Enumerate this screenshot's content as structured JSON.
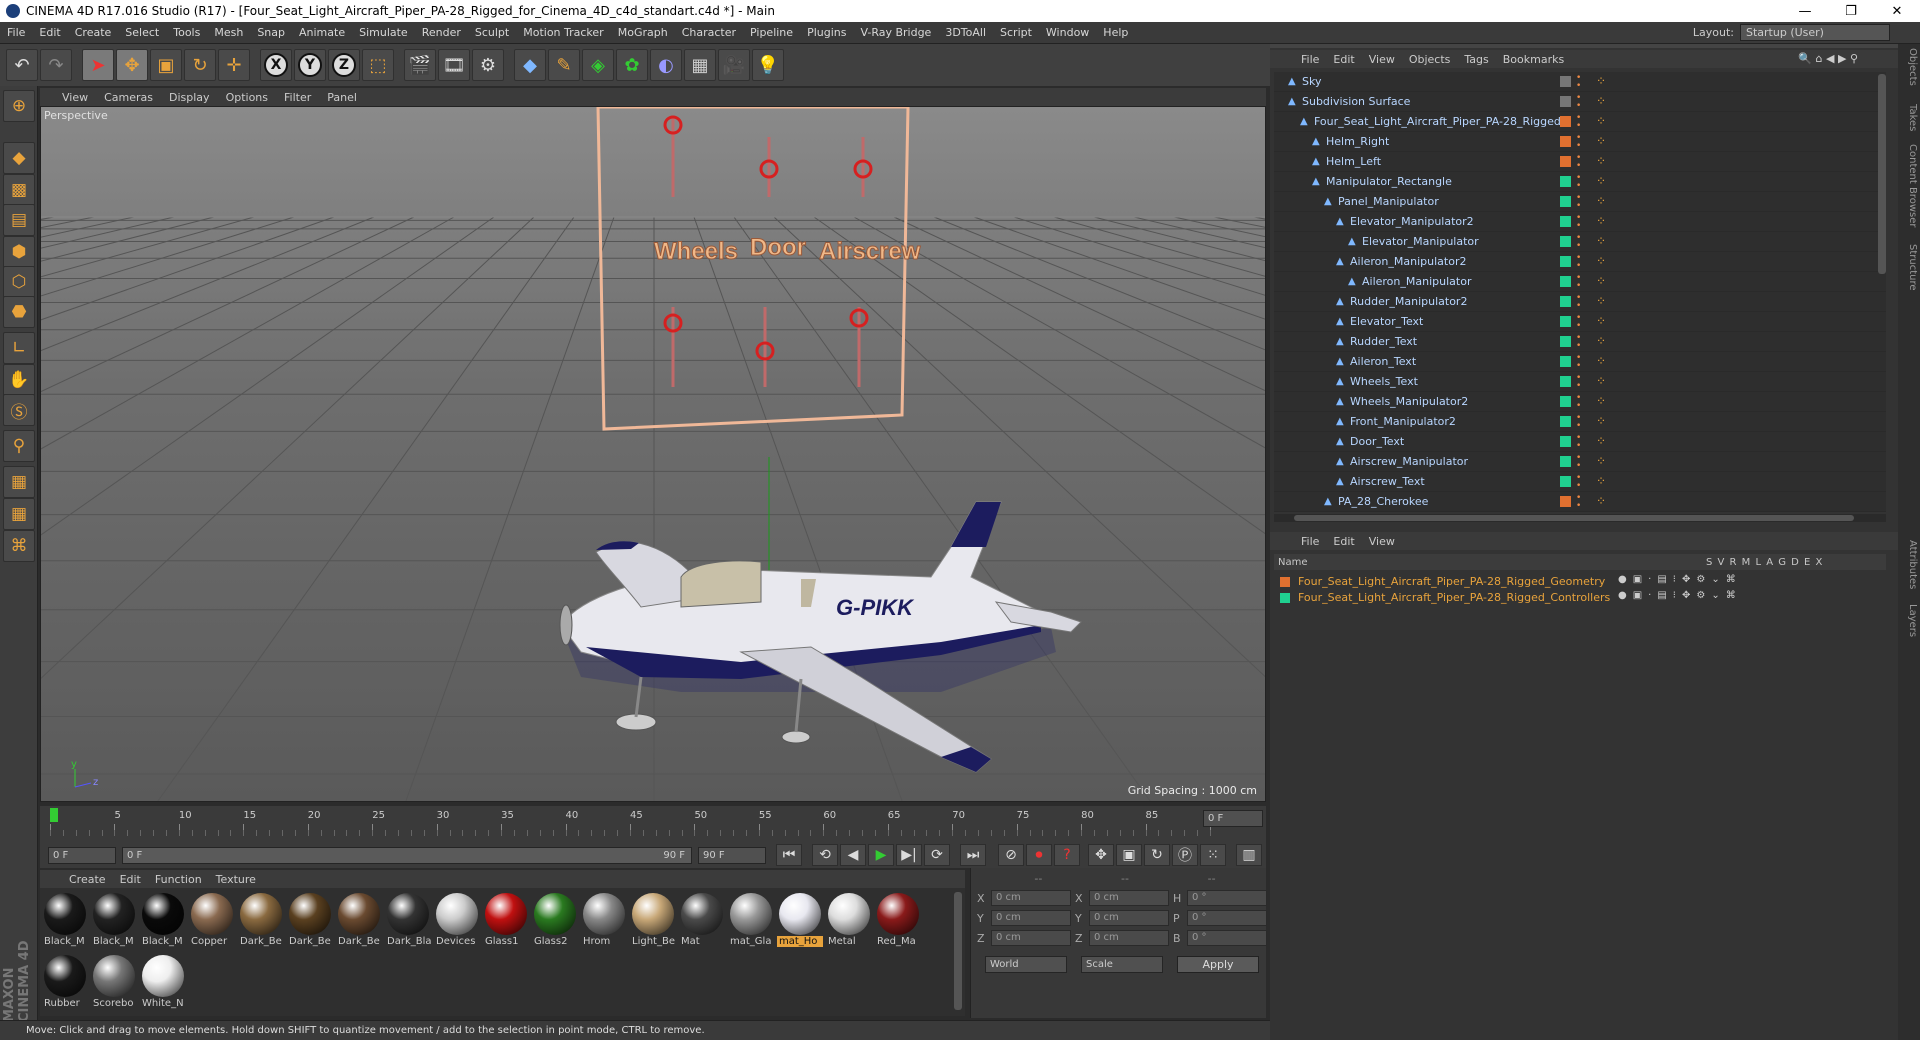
{
  "window": {
    "title": "CINEMA 4D R17.016 Studio (R17) - [Four_Seat_Light_Aircraft_Piper_PA-28_Rigged_for_Cinema_4D_c4d_standart.c4d *] - Main"
  },
  "menu": [
    "File",
    "Edit",
    "Create",
    "Select",
    "Tools",
    "Mesh",
    "Snap",
    "Animate",
    "Simulate",
    "Render",
    "Sculpt",
    "Motion Tracker",
    "MoGraph",
    "Character",
    "Pipeline",
    "Plugins",
    "V-Ray Bridge",
    "3DToAll",
    "Script",
    "Window",
    "Help"
  ],
  "layout": {
    "label": "Layout:",
    "value": "Startup (User)"
  },
  "viewport": {
    "menu": [
      "View",
      "Cameras",
      "Display",
      "Options",
      "Filter",
      "Panel"
    ],
    "label": "Perspective",
    "grid_spacing": "Grid Spacing : 1000 cm",
    "panel_labels": [
      "Wheels",
      "Door",
      "Airscrew"
    ],
    "aircraft_reg": "G-PIKK",
    "axis_y": "y",
    "axis_z": "z"
  },
  "timeline": {
    "ticks": [
      "0",
      "5",
      "10",
      "15",
      "20",
      "25",
      "30",
      "35",
      "40",
      "45",
      "50",
      "55",
      "60",
      "65",
      "70",
      "75",
      "80",
      "85",
      "90"
    ],
    "current": "0 F",
    "start": "0 F",
    "range_start": "0 F",
    "range_end": "90 F",
    "end": "90 F"
  },
  "materials": {
    "menu": [
      "Create",
      "Edit",
      "Function",
      "Texture"
    ],
    "items": [
      {
        "name": "Black_M",
        "color": "#1a1a1a"
      },
      {
        "name": "Black_M",
        "color": "#222222"
      },
      {
        "name": "Black_M",
        "color": "#0a0a0a"
      },
      {
        "name": "Copper",
        "color": "#8a6a50"
      },
      {
        "name": "Dark_Be",
        "color": "#8a6a40"
      },
      {
        "name": "Dark_Be",
        "color": "#5a4020"
      },
      {
        "name": "Dark_Be",
        "color": "#6a4a30"
      },
      {
        "name": "Dark_Bla",
        "color": "#333333"
      },
      {
        "name": "Devices",
        "color": "#cccccc"
      },
      {
        "name": "Glass1",
        "color": "#c01010"
      },
      {
        "name": "Glass2",
        "color": "#2a7a20"
      },
      {
        "name": "Hrom",
        "color": "#888888"
      },
      {
        "name": "Light_Be",
        "color": "#c8a878"
      },
      {
        "name": "Mat",
        "color": "#4a4a4a"
      },
      {
        "name": "mat_Gla",
        "color": "#999999"
      },
      {
        "name": "mat_Ho",
        "color": "#e8e8f0"
      },
      {
        "name": "Metal",
        "color": "#dddddd"
      },
      {
        "name": "Red_Ma",
        "color": "#8a1a1a"
      },
      {
        "name": "Rubber",
        "color": "#1a1a1a"
      },
      {
        "name": "Scorebo",
        "color": "#777777"
      },
      {
        "name": "White_N",
        "color": "#eeeeee"
      }
    ]
  },
  "coords": {
    "headers": [
      "--",
      "--",
      "--"
    ],
    "rows": [
      {
        "a": "X",
        "av": "0 cm",
        "b": "X",
        "bv": "0 cm",
        "c": "H",
        "cv": "0 °"
      },
      {
        "a": "Y",
        "av": "0 cm",
        "b": "Y",
        "bv": "0 cm",
        "c": "P",
        "cv": "0 °"
      },
      {
        "a": "Z",
        "av": "0 cm",
        "b": "Z",
        "bv": "0 cm",
        "c": "B",
        "cv": "0 °"
      }
    ],
    "mode": "World",
    "scale": "Scale",
    "apply": "Apply"
  },
  "status": "Move: Click and drag to move elements. Hold down SHIFT to quantize movement / add to the selection in point mode, CTRL to remove.",
  "objects": {
    "menu": [
      "File",
      "Edit",
      "View",
      "Objects",
      "Tags",
      "Bookmarks"
    ],
    "rows": [
      {
        "name": "Sky",
        "indent": 0,
        "color": "#777777"
      },
      {
        "name": "Subdivision Surface",
        "indent": 0,
        "color": "#777777"
      },
      {
        "name": "Four_Seat_Light_Aircraft_Piper_PA-28_Rigged",
        "indent": 1,
        "color": "#e07030"
      },
      {
        "name": "Helm_Right",
        "indent": 2,
        "color": "#e07030"
      },
      {
        "name": "Helm_Left",
        "indent": 2,
        "color": "#e07030"
      },
      {
        "name": "Manipulator_Rectangle",
        "indent": 2,
        "color": "#20d090"
      },
      {
        "name": "Panel_Manipulator",
        "indent": 3,
        "color": "#20d090"
      },
      {
        "name": "Elevator_Manipulator2",
        "indent": 4,
        "color": "#20d090"
      },
      {
        "name": "Elevator_Manipulator",
        "indent": 5,
        "color": "#20d090"
      },
      {
        "name": "Aileron_Manipulator2",
        "indent": 4,
        "color": "#20d090"
      },
      {
        "name": "Aileron_Manipulator",
        "indent": 5,
        "color": "#20d090"
      },
      {
        "name": "Rudder_Manipulator2",
        "indent": 4,
        "color": "#20d090"
      },
      {
        "name": "Elevator_Text",
        "indent": 4,
        "color": "#20d090"
      },
      {
        "name": "Rudder_Text",
        "indent": 4,
        "color": "#20d090"
      },
      {
        "name": "Aileron_Text",
        "indent": 4,
        "color": "#20d090"
      },
      {
        "name": "Wheels_Text",
        "indent": 4,
        "color": "#20d090"
      },
      {
        "name": "Wheels_Manipulator2",
        "indent": 4,
        "color": "#20d090"
      },
      {
        "name": "Front_Manipulator2",
        "indent": 4,
        "color": "#20d090"
      },
      {
        "name": "Door_Text",
        "indent": 4,
        "color": "#20d090"
      },
      {
        "name": "Airscrew_Manipulator",
        "indent": 4,
        "color": "#20d090"
      },
      {
        "name": "Airscrew_Text",
        "indent": 4,
        "color": "#20d090"
      },
      {
        "name": "PA_28_Cherokee",
        "indent": 3,
        "color": "#e07030"
      }
    ]
  },
  "layers": {
    "menu": [
      "File",
      "Edit",
      "View"
    ],
    "header_name": "Name",
    "header_cols": "S V R M L A G D E X",
    "rows": [
      {
        "name": "Four_Seat_Light_Aircraft_Piper_PA-28_Rigged_Geometry",
        "color": "#e07030"
      },
      {
        "name": "Four_Seat_Light_Aircraft_Piper_PA-28_Rigged_Controllers",
        "color": "#20d090"
      }
    ]
  },
  "sidetabs": [
    "Objects",
    "Takes",
    "Content Browser",
    "Structure",
    "Attributes",
    "Layers"
  ],
  "brand": "MAXON CINEMA 4D"
}
